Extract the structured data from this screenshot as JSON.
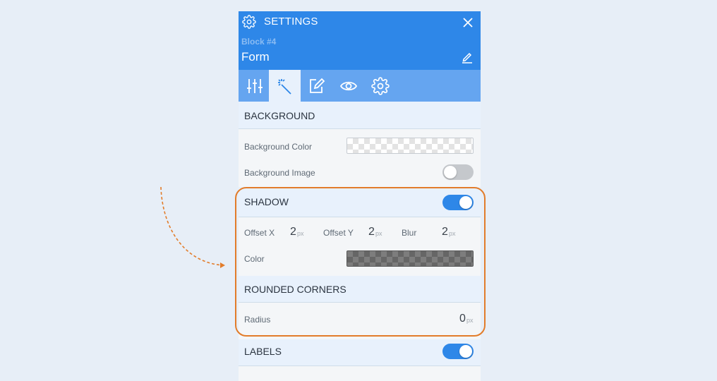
{
  "header": {
    "title": "SETTINGS",
    "block_id": "Block #4",
    "block_name": "Form"
  },
  "tabs": [
    {
      "name": "layout",
      "icon": "sliders-icon",
      "active": false
    },
    {
      "name": "styles",
      "icon": "magic-wand-icon",
      "active": true
    },
    {
      "name": "edit",
      "icon": "edit-icon",
      "active": false
    },
    {
      "name": "visibility",
      "icon": "eye-icon",
      "active": false
    },
    {
      "name": "settings",
      "icon": "gear-icon",
      "active": false
    }
  ],
  "background": {
    "heading": "BACKGROUND",
    "color_label": "Background Color",
    "image_label": "Background Image",
    "image_enabled": false
  },
  "shadow": {
    "heading": "SHADOW",
    "enabled": true,
    "offset_x_label": "Offset X",
    "offset_x_value": "2",
    "offset_y_label": "Offset Y",
    "offset_y_value": "2",
    "blur_label": "Blur",
    "blur_value": "2",
    "unit": "px",
    "color_label": "Color"
  },
  "rounded_corners": {
    "heading": "ROUNDED CORNERS",
    "radius_label": "Radius",
    "radius_value": "0",
    "unit": "px"
  },
  "labels": {
    "heading": "LABELS",
    "enabled": true
  },
  "colors": {
    "header_bg": "#2e87e8",
    "tabs_bg": "#65a5f0",
    "toggle_on": "#2e87e8",
    "highlight": "#e27c2a"
  }
}
